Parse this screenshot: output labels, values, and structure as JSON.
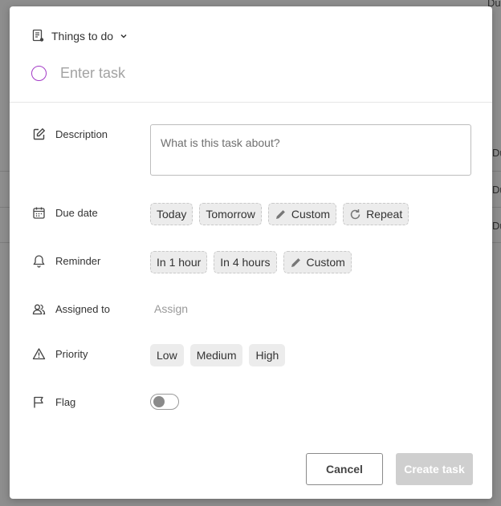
{
  "background": {
    "column_labels": [
      "Du",
      "Du",
      "Du",
      "Du"
    ]
  },
  "header": {
    "list_name": "Things to do",
    "task_placeholder": "Enter task"
  },
  "fields": {
    "description": {
      "label": "Description",
      "placeholder": "What is this task about?"
    },
    "due_date": {
      "label": "Due date",
      "options": [
        "Today",
        "Tomorrow",
        "Custom",
        "Repeat"
      ]
    },
    "reminder": {
      "label": "Reminder",
      "options": [
        "In 1 hour",
        "In 4 hours",
        "Custom"
      ]
    },
    "assigned_to": {
      "label": "Assigned to",
      "value": "Assign"
    },
    "priority": {
      "label": "Priority",
      "options": [
        "Low",
        "Medium",
        "High"
      ]
    },
    "flag": {
      "label": "Flag",
      "enabled": false
    }
  },
  "footer": {
    "cancel_label": "Cancel",
    "create_label": "Create task"
  },
  "colors": {
    "accent_circle": "#a33ac7",
    "create_disabled_bg": "#cfcfcf"
  },
  "icons": {
    "list": "list-icon",
    "chevron": "chevron-down-icon",
    "description": "edit-icon",
    "due_date": "calendar-icon",
    "reminder": "bell-icon",
    "assigned_to": "users-icon",
    "priority": "warning-icon",
    "flag": "flag-icon",
    "custom": "pencil-icon",
    "repeat": "repeat-icon"
  }
}
